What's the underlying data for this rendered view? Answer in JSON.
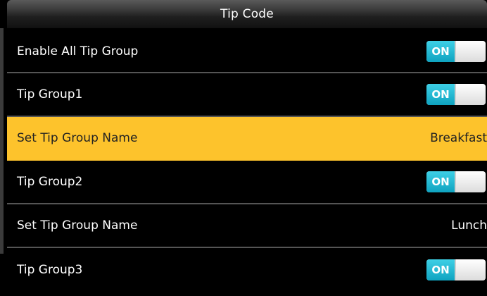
{
  "header": {
    "title": "Tip Code"
  },
  "rows": [
    {
      "label": "Enable All Tip Group",
      "toggle_label": "ON"
    },
    {
      "label": "Tip Group1",
      "toggle_label": "ON"
    },
    {
      "label": "Set Tip Group Name",
      "value": "Breakfast"
    },
    {
      "label": "Tip Group2",
      "toggle_label": "ON"
    },
    {
      "label": "Set Tip Group Name",
      "value": "Lunch"
    },
    {
      "label": "Tip Group3",
      "toggle_label": "ON"
    }
  ],
  "colors": {
    "selected_row": "#fdc32c",
    "toggle_on": "#1fb8d4",
    "background": "#000000"
  }
}
